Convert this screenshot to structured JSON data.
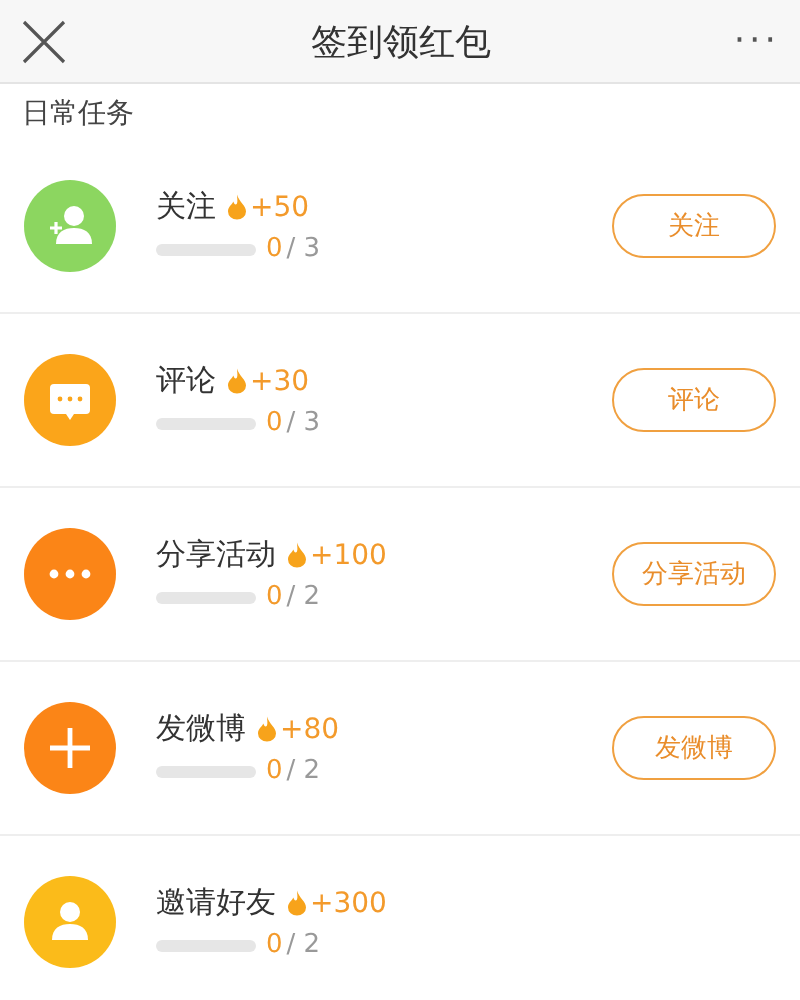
{
  "header": {
    "title": "签到领红包",
    "more": "···"
  },
  "section_title": "日常任务",
  "tasks": [
    {
      "name": "关注",
      "reward": "+50",
      "count": "0",
      "total": "/ 3",
      "kind": "follow",
      "color": "#8cd660",
      "button": "关注"
    },
    {
      "name": "评论",
      "reward": "+30",
      "count": "0",
      "total": "/ 3",
      "kind": "comment",
      "color": "#fba51a",
      "button": "评论"
    },
    {
      "name": "分享活动",
      "reward": "+100",
      "count": "0",
      "total": "/ 2",
      "kind": "more",
      "color": "#fb8517",
      "button": "分享活动"
    },
    {
      "name": "发微博",
      "reward": "+80",
      "count": "0",
      "total": "/ 2",
      "kind": "plus",
      "color": "#fb8517",
      "button": "发微博"
    },
    {
      "name": "邀请好友",
      "reward": "+300",
      "count": "0",
      "total": "/ 2",
      "kind": "person",
      "color": "#fbbb1a"
    }
  ]
}
